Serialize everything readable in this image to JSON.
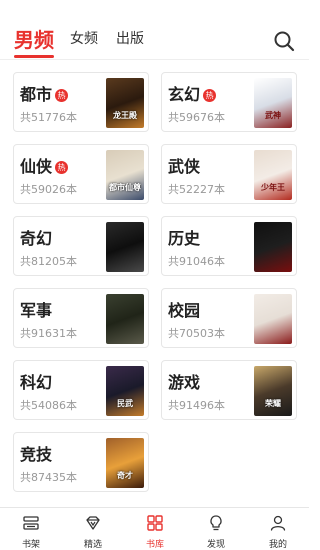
{
  "header": {
    "tabs": [
      {
        "label": "男频",
        "active": true
      },
      {
        "label": "女频",
        "active": false
      },
      {
        "label": "出版",
        "active": false
      }
    ],
    "search_icon": "search-icon"
  },
  "categories": [
    {
      "name": "都市",
      "hot": true,
      "count": "共51776本",
      "cover_text": "龙王殿"
    },
    {
      "name": "玄幻",
      "hot": true,
      "count": "共59676本",
      "cover_text": "武神"
    },
    {
      "name": "仙侠",
      "hot": true,
      "count": "共59026本",
      "cover_text": "都市仙尊"
    },
    {
      "name": "武侠",
      "hot": false,
      "count": "共52227本",
      "cover_text": "少年王"
    },
    {
      "name": "奇幻",
      "hot": false,
      "count": "共81205本",
      "cover_text": ""
    },
    {
      "name": "历史",
      "hot": false,
      "count": "共91046本",
      "cover_text": ""
    },
    {
      "name": "军事",
      "hot": false,
      "count": "共91631本",
      "cover_text": ""
    },
    {
      "name": "校园",
      "hot": false,
      "count": "共70503本",
      "cover_text": ""
    },
    {
      "name": "科幻",
      "hot": false,
      "count": "共54086本",
      "cover_text": "民武"
    },
    {
      "name": "游戏",
      "hot": false,
      "count": "共91496本",
      "cover_text": "荣耀"
    },
    {
      "name": "竞技",
      "hot": false,
      "count": "共87435本",
      "cover_text": "奇才"
    }
  ],
  "hot_badge": "热",
  "bottom_nav": [
    {
      "label": "书架",
      "icon": "bookshelf-icon",
      "active": false
    },
    {
      "label": "精选",
      "icon": "diamond-icon",
      "active": false
    },
    {
      "label": "书库",
      "icon": "library-grid-icon",
      "active": true
    },
    {
      "label": "发现",
      "icon": "lightbulb-icon",
      "active": false
    },
    {
      "label": "我的",
      "icon": "profile-icon",
      "active": false
    }
  ],
  "colors": {
    "accent": "#e8322e",
    "text": "#333333",
    "muted": "#999999",
    "border": "#e6e6e6"
  }
}
